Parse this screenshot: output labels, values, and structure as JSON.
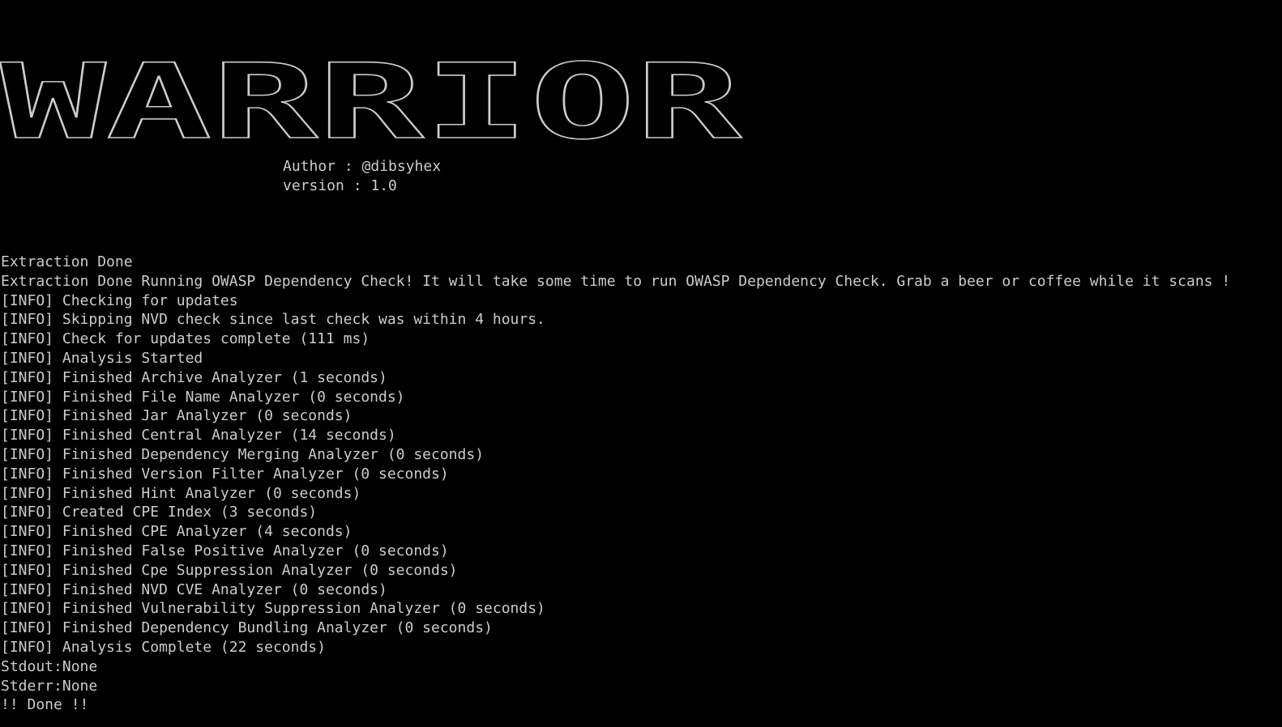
{
  "terminal": {
    "banner_text": "WARRIOR",
    "banner_ascii": [
      "____   __   ____  ___      .______      .______      __    ______   .______",
      "\\   \\ /  \\ /   / /   \\     |   _  \\     |   _  \\    |  |  /  __  \\  |   _  \\",
      " \\   \\/    \\/   / /  ^  \\    |  |_)  |    |  |_)  |   |  | |  |  |  | |  |_)  |",
      "  \\            / /  /_\\  \\   |      /     |      /    |  | |  |  |  | |      /",
      "   \\    /\\    / /  _____  \\  |  |\\  \\----.|  |\\  \\----.|  | |  `--'  | |  |\\  \\----.",
      "    \\__/  \\__/ /__/     \\__\\ | _| `._____|| _| `._____||__|  \\______/  | _| `._____|"
    ],
    "author_line": "Author : @dibsyhex",
    "version_line": "version : 1.0",
    "log_lines": [
      "Extraction Done",
      "Extraction Done Running OWASP Dependency Check! It will take some time to run OWASP Dependency Check. Grab a beer or coffee while it scans !",
      "[INFO] Checking for updates",
      "[INFO] Skipping NVD check since last check was within 4 hours.",
      "[INFO] Check for updates complete (111 ms)",
      "[INFO] Analysis Started",
      "[INFO] Finished Archive Analyzer (1 seconds)",
      "[INFO] Finished File Name Analyzer (0 seconds)",
      "[INFO] Finished Jar Analyzer (0 seconds)",
      "[INFO] Finished Central Analyzer (14 seconds)",
      "[INFO] Finished Dependency Merging Analyzer (0 seconds)",
      "[INFO] Finished Version Filter Analyzer (0 seconds)",
      "[INFO] Finished Hint Analyzer (0 seconds)",
      "[INFO] Created CPE Index (3 seconds)",
      "[INFO] Finished CPE Analyzer (4 seconds)",
      "[INFO] Finished False Positive Analyzer (0 seconds)",
      "[INFO] Finished Cpe Suppression Analyzer (0 seconds)",
      "[INFO] Finished NVD CVE Analyzer (0 seconds)",
      "[INFO] Finished Vulnerability Suppression Analyzer (0 seconds)",
      "[INFO] Finished Dependency Bundling Analyzer (0 seconds)",
      "[INFO] Analysis Complete (22 seconds)",
      "Stdout:None",
      "Stderr:None",
      "!! Done !!"
    ]
  },
  "colors": {
    "background": "#000000",
    "text": "#cccccc"
  }
}
